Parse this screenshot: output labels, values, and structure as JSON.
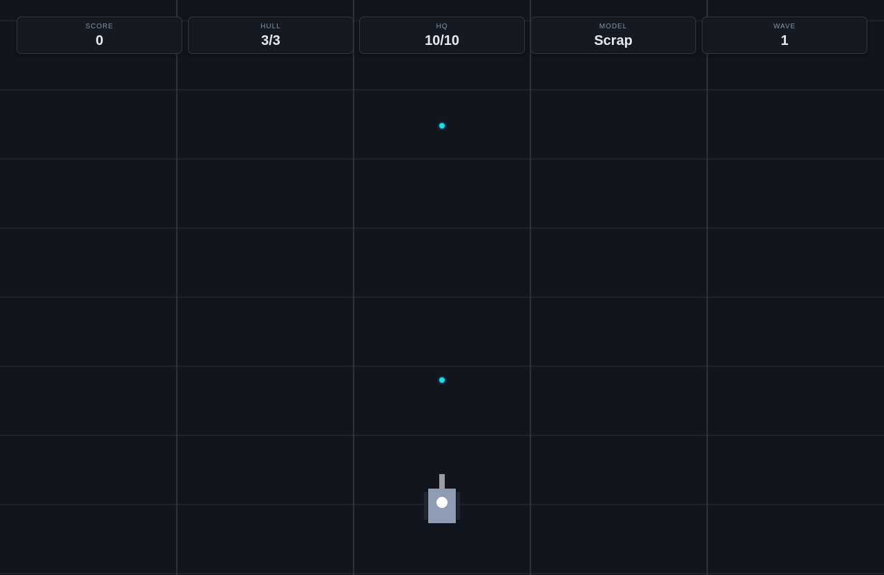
{
  "hud": {
    "stats": [
      {
        "label": "SCORE",
        "value": "0"
      },
      {
        "label": "HULL",
        "value": "3/3"
      },
      {
        "label": "HQ",
        "value": "10/10"
      },
      {
        "label": "MODEL",
        "value": "Scrap"
      },
      {
        "label": "WAVE",
        "value": "1"
      }
    ]
  },
  "colors": {
    "background": "#11151d",
    "projectile": "#23d8f0",
    "tank_body": "#8e9cb4",
    "tank_turret": "#ffffff",
    "tank_barrel": "#9c9ea4"
  },
  "icons": {
    "player": "tank-icon",
    "projectile": "energy-orb-icon"
  }
}
